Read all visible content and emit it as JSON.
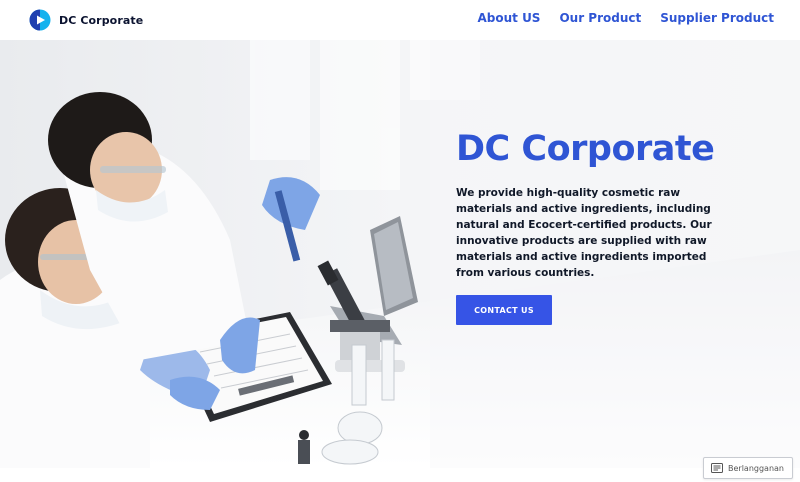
{
  "site": {
    "brand": "DC Corporate"
  },
  "nav": {
    "items": [
      {
        "label": "About US"
      },
      {
        "label": "Our Product"
      },
      {
        "label": "Supplier Product"
      }
    ]
  },
  "hero": {
    "title": "DC Corporate",
    "description": "We provide high-quality cosmetic raw materials and active ingredients, including natural and Ecocert-certified products. Our innovative products are supplied with raw materials and active ingredients imported from various countries.",
    "cta_label": "CONTACT US",
    "image_subject": "two scientists in lab coats, masks and blue gloves examining a test tube next to a microscope, clipboard and laptop"
  },
  "subscribe": {
    "label": "Berlangganan",
    "icon": "reader-icon"
  },
  "colors": {
    "accent": "#2f55d4",
    "button": "#3654e6",
    "text_dark": "#101828",
    "glove_blue": "#7ea5e6"
  }
}
